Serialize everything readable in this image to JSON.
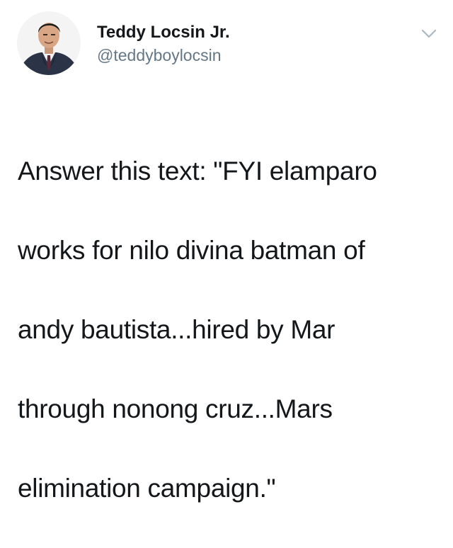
{
  "tweet": {
    "author": {
      "name": "Teddy Locsin Jr.",
      "handle": "@teddyboylocsin",
      "avatar_icon": "profile-photo"
    },
    "menu_icon": "chevron-down-icon",
    "text_lines": [
      "Answer this text: \"FYI elamparo",
      "works for nilo divina batman of",
      "andy bautista...hired by Mar",
      "through nonong cruz...Mars",
      "elimination campaign.\""
    ]
  },
  "colors": {
    "text": "#14171a",
    "secondary_text": "#657786",
    "chevron": "#aab8c2",
    "background": "#ffffff"
  }
}
